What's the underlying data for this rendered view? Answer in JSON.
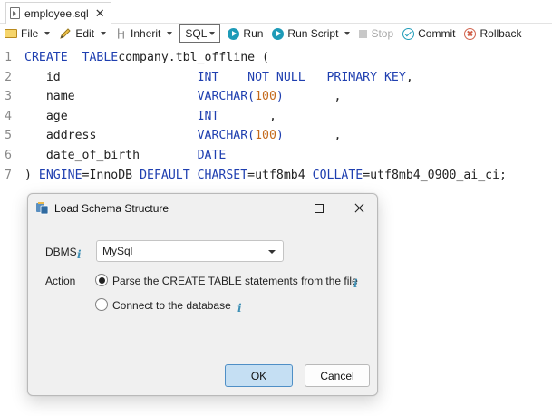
{
  "tab": {
    "title": "employee.sql",
    "close": "✕"
  },
  "toolbar": {
    "file": "File",
    "edit": "Edit",
    "inherit": "Inherit",
    "sql": "SQL",
    "run": "Run",
    "run_script": "Run Script",
    "stop": "Stop",
    "commit": "Commit",
    "rollback": "Rollback"
  },
  "editor": {
    "lines": [
      {
        "n": "1",
        "parts": [
          [
            "kw",
            "CREATE  TABLE"
          ],
          [
            "",
            "company.tbl_offline ("
          ]
        ]
      },
      {
        "n": "2",
        "parts": [
          [
            "",
            "   id                   "
          ],
          [
            "kw",
            "INT    NOT NULL   PRIMARY KEY"
          ],
          [
            "",
            ","
          ]
        ]
      },
      {
        "n": "3",
        "parts": [
          [
            "",
            "   name                 "
          ],
          [
            "kw",
            "VARCHAR("
          ],
          [
            "num",
            "100"
          ],
          [
            "kw",
            ")"
          ],
          [
            "",
            "       ,"
          ]
        ]
      },
      {
        "n": "4",
        "parts": [
          [
            "",
            "   age                  "
          ],
          [
            "kw",
            "INT"
          ],
          [
            "",
            "       ,"
          ]
        ]
      },
      {
        "n": "5",
        "parts": [
          [
            "",
            "   address              "
          ],
          [
            "kw",
            "VARCHAR("
          ],
          [
            "num",
            "100"
          ],
          [
            "kw",
            ")"
          ],
          [
            "",
            "       ,"
          ]
        ]
      },
      {
        "n": "6",
        "parts": [
          [
            "",
            "   date_of_birth        "
          ],
          [
            "kw",
            "DATE"
          ]
        ]
      },
      {
        "n": "7",
        "parts": [
          [
            "",
            ") "
          ],
          [
            "kw",
            "ENGINE"
          ],
          [
            "",
            "=InnoDB "
          ],
          [
            "kw",
            "DEFAULT CHARSET"
          ],
          [
            "",
            "=utf8mb4 "
          ],
          [
            "kw",
            "COLLATE"
          ],
          [
            "",
            "=utf8mb4_0900_ai_ci;"
          ]
        ]
      }
    ]
  },
  "dialog": {
    "title": "Load Schema Structure",
    "dbms_label": "DBMS",
    "dbms_value": "MySql",
    "action_label": "Action",
    "option_parse": "Parse the CREATE TABLE statements from the file",
    "option_connect": "Connect to the database",
    "info_glyph": "i",
    "ok": "OK",
    "cancel": "Cancel",
    "selected_option": "parse"
  },
  "colors": {
    "keyword": "#1f3fb0",
    "number": "#c46a1c",
    "accent": "#1e9bb8"
  }
}
